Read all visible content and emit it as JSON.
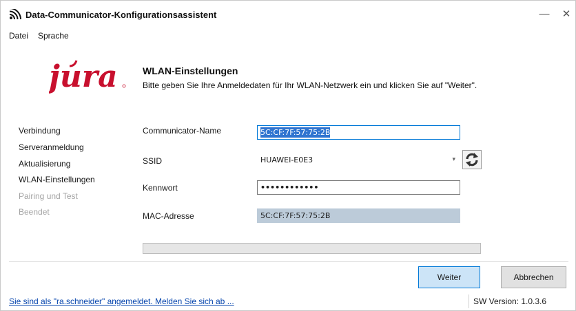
{
  "window": {
    "title": "Data-Communicator-Konfigurationsassistent",
    "minimize_glyph": "—",
    "close_glyph": "✕"
  },
  "menu": [
    "Datei",
    "Sprache"
  ],
  "logo": {
    "text": "jura",
    "color": "#c8102e"
  },
  "header": {
    "title": "WLAN-Einstellungen",
    "subtitle": "Bitte geben Sie Ihre Anmeldedaten für Ihr WLAN-Netzwerk ein und klicken Sie auf \"Weiter\"."
  },
  "steps": [
    {
      "label": "Verbindung",
      "state": "done"
    },
    {
      "label": "Serveranmeldung",
      "state": "done"
    },
    {
      "label": "Aktualisierung",
      "state": "done"
    },
    {
      "label": "WLAN-Einstellungen",
      "state": "current"
    },
    {
      "label": "Pairing und Test",
      "state": "pending"
    },
    {
      "label": "Beendet",
      "state": "pending"
    }
  ],
  "form": {
    "communicator_name": {
      "label": "Communicator-Name",
      "value": "5C:CF:7F:57:75:2B"
    },
    "ssid": {
      "label": "SSID",
      "value": "HUAWEI-E0E3",
      "refresh_icon": "refresh-icon"
    },
    "password": {
      "label": "Kennwort",
      "value": "••••••••••••"
    },
    "mac": {
      "label": "MAC-Adresse",
      "value": "5C:CF:7F:57:75:2B"
    }
  },
  "progress": {
    "value": 0
  },
  "buttons": {
    "next": "Weiter",
    "cancel": "Abbrechen"
  },
  "status": {
    "login_text": "Sie sind als \"ra.schneider\" angemeldet. Melden Sie sich ab ...",
    "version": "SW Version:  1.0.3.6"
  },
  "colors": {
    "accent": "#0078d7",
    "selection": "#2f74d0",
    "mac_bg": "#bccbd9",
    "link": "#0645ad"
  }
}
